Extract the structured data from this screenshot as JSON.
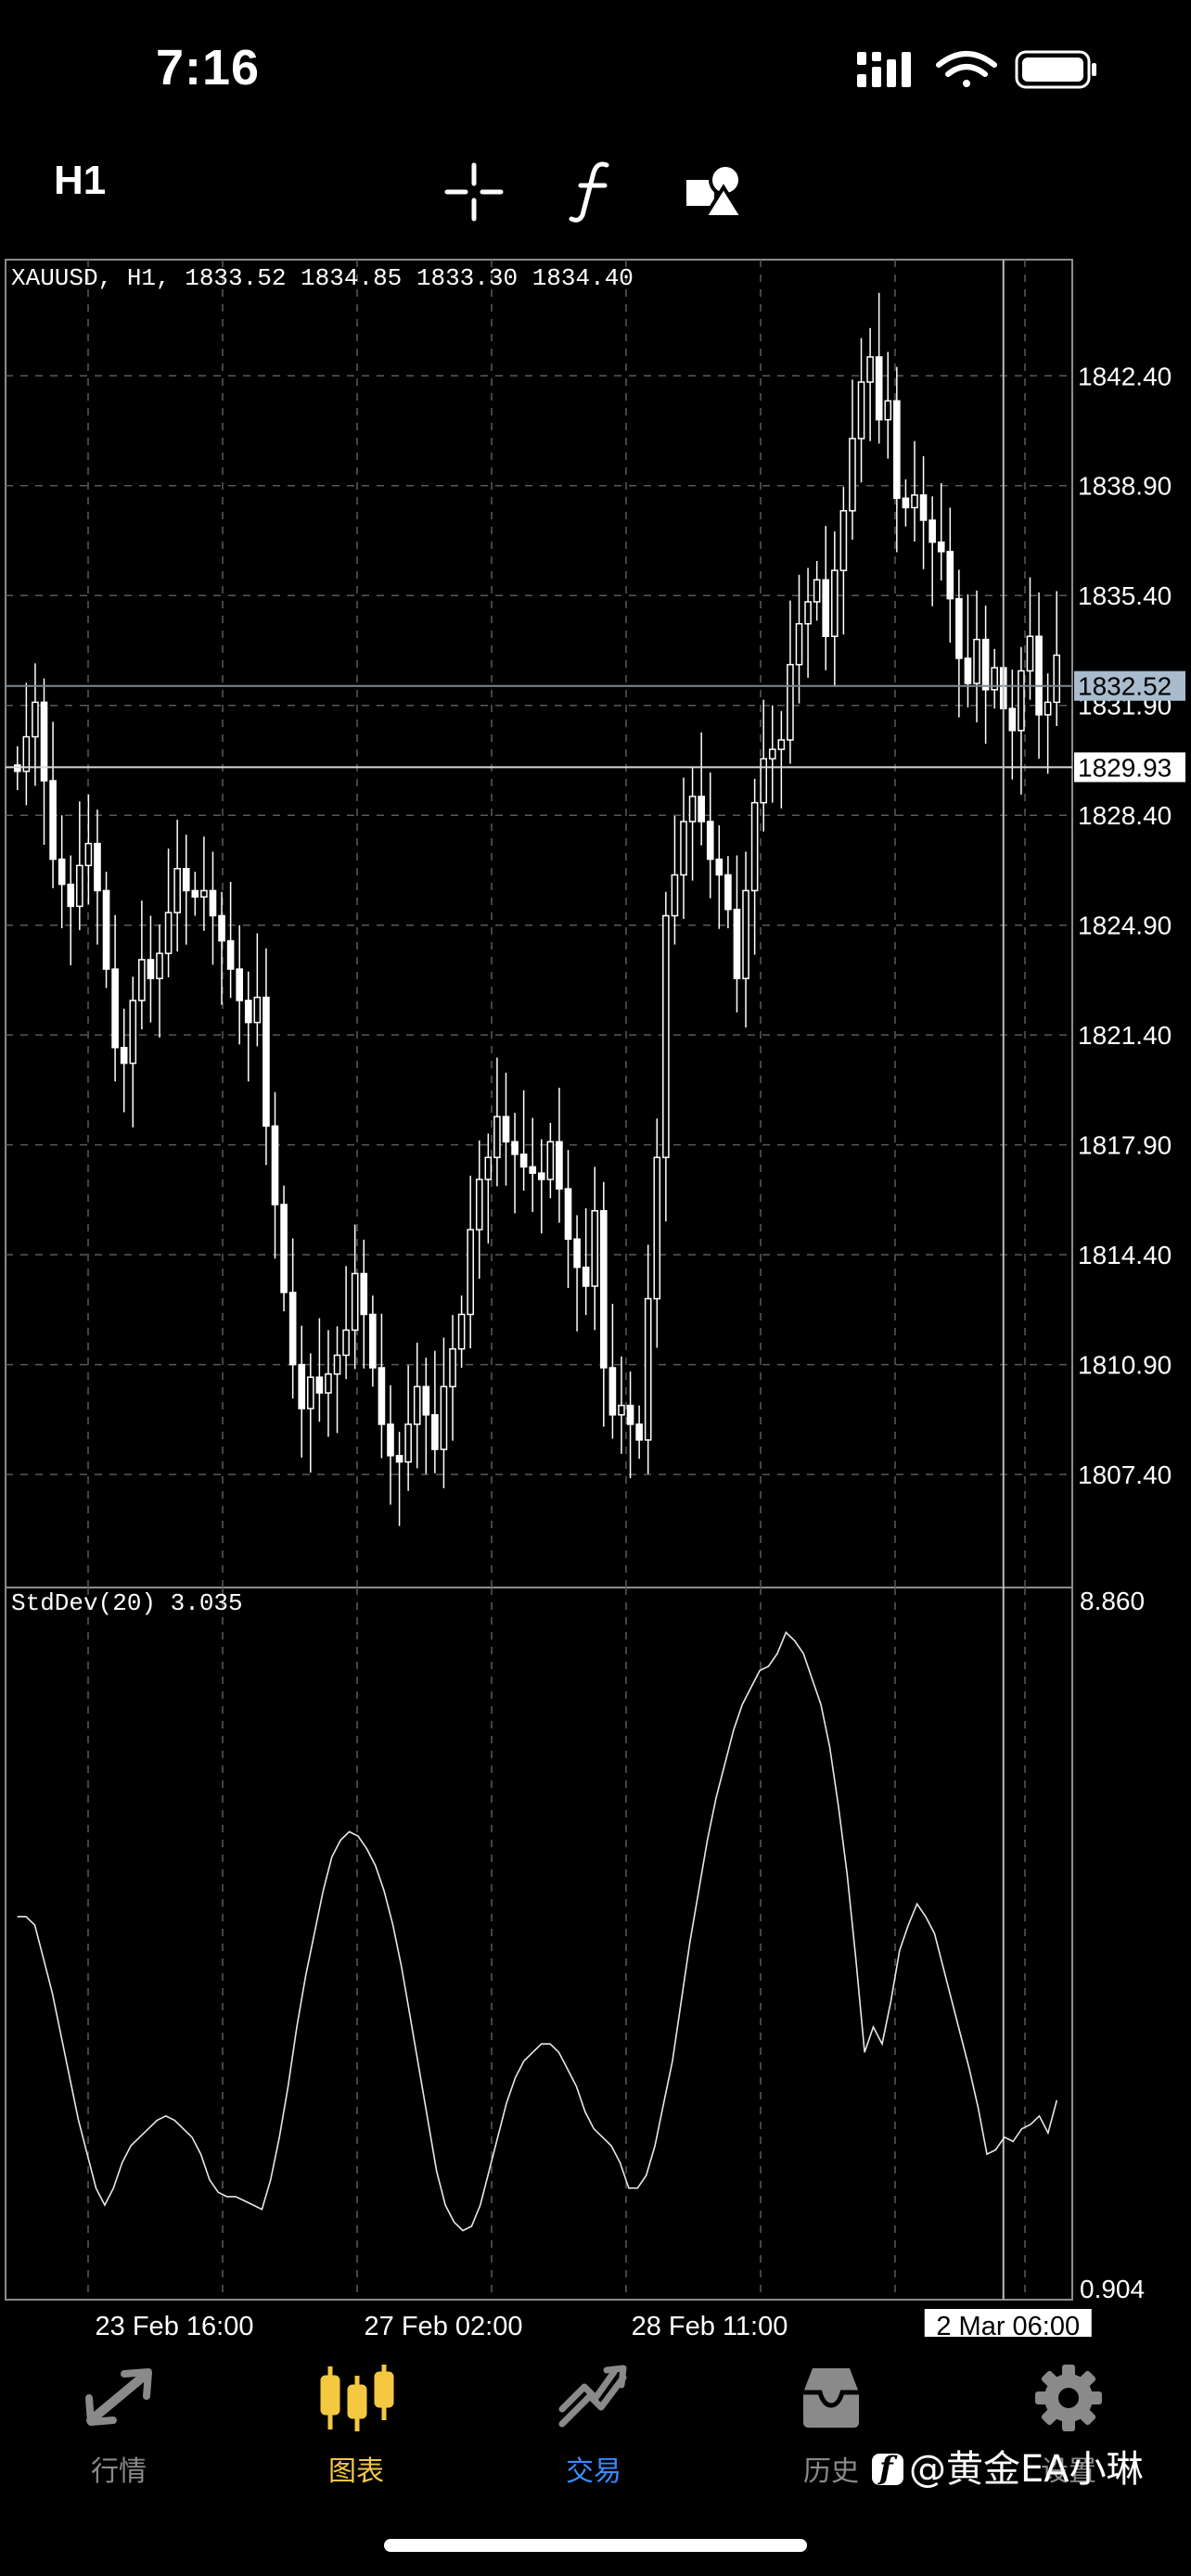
{
  "status_bar": {
    "time": "7:16"
  },
  "toolbar": {
    "timeframe": "H1",
    "icons": [
      "crosshair-icon",
      "function-icon",
      "objects-icon"
    ]
  },
  "chart_header": "XAUUSD, H1, 1833.52 1834.85 1833.30 1834.40",
  "indicator_header": "StdDev(20) 3.035",
  "current_price_label": "1832.52",
  "crosshair_price_label": "1829.93",
  "crosshair_time_label": "2 Mar 06:00",
  "chart_data": [
    {
      "type": "candlestick",
      "symbol": "XAUUSD",
      "timeframe": "H1",
      "ylim": [
        1803.8,
        1846.1
      ],
      "y_ticks": [
        "1842.40",
        "1838.90",
        "1835.40",
        "1831.90",
        "1828.40",
        "1824.90",
        "1821.40",
        "1817.90",
        "1814.40",
        "1810.90",
        "1807.40"
      ],
      "x_ticks": [
        "23 Feb 16:00",
        "27 Feb 02:00",
        "28 Feb 11:00"
      ],
      "current_price": 1832.52,
      "crosshair_price": 1829.93,
      "closes": [
        1829.8,
        1830.9,
        1832.0,
        1829.5,
        1827.0,
        1826.2,
        1825.5,
        1826.8,
        1827.5,
        1826.0,
        1823.5,
        1821.0,
        1820.5,
        1822.5,
        1823.8,
        1823.2,
        1824.0,
        1825.3,
        1826.7,
        1826.0,
        1825.8,
        1826.0,
        1825.2,
        1824.4,
        1823.5,
        1822.5,
        1821.8,
        1822.6,
        1818.5,
        1816.0,
        1813.2,
        1810.9,
        1809.5,
        1810.5,
        1810.0,
        1810.6,
        1811.2,
        1812.0,
        1813.8,
        1812.5,
        1810.8,
        1809.0,
        1808.0,
        1807.8,
        1809.0,
        1810.2,
        1809.3,
        1808.2,
        1810.2,
        1811.4,
        1812.5,
        1815.2,
        1816.8,
        1817.5,
        1818.8,
        1818.0,
        1817.6,
        1817.2,
        1817.0,
        1816.8,
        1818.0,
        1816.5,
        1814.9,
        1814.0,
        1813.4,
        1815.8,
        1810.8,
        1809.3,
        1809.6,
        1809.0,
        1808.5,
        1813.0,
        1817.5,
        1825.2,
        1826.5,
        1828.2,
        1829.0,
        1828.2,
        1827.0,
        1826.5,
        1825.4,
        1823.2,
        1826.0,
        1828.8,
        1830.2,
        1830.5,
        1830.8,
        1833.2,
        1834.5,
        1835.2,
        1835.9,
        1834.1,
        1836.2,
        1838.1,
        1840.4,
        1842.2,
        1843.0,
        1841.0,
        1841.6,
        1838.5,
        1838.2,
        1838.6,
        1837.8,
        1837.1,
        1836.8,
        1835.3,
        1833.4,
        1832.6,
        1834.0,
        1832.4,
        1833.1,
        1831.8,
        1831.1,
        1833.0,
        1834.1,
        1831.6,
        1832.0,
        1833.5
      ],
      "indicator": {
        "name": "StdDev(20)",
        "last_value": 3.035,
        "ylim": [
          0.904,
          8.86
        ],
        "values": [
          5.2,
          5.2,
          5.1,
          4.7,
          4.3,
          3.8,
          3.3,
          2.8,
          2.4,
          2.0,
          1.8,
          2.0,
          2.3,
          2.5,
          2.6,
          2.7,
          2.8,
          2.85,
          2.8,
          2.7,
          2.6,
          2.4,
          2.1,
          1.95,
          1.9,
          1.9,
          1.85,
          1.8,
          1.75,
          2.1,
          2.6,
          3.2,
          3.9,
          4.5,
          5.0,
          5.5,
          5.9,
          6.1,
          6.2,
          6.15,
          6.0,
          5.8,
          5.5,
          5.1,
          4.6,
          4.0,
          3.4,
          2.8,
          2.2,
          1.8,
          1.6,
          1.5,
          1.55,
          1.8,
          2.2,
          2.6,
          3.0,
          3.3,
          3.5,
          3.6,
          3.7,
          3.7,
          3.6,
          3.4,
          3.2,
          2.9,
          2.7,
          2.6,
          2.5,
          2.3,
          2.0,
          2.0,
          2.15,
          2.5,
          3.0,
          3.5,
          4.2,
          4.9,
          5.5,
          6.1,
          6.6,
          7.0,
          7.4,
          7.7,
          7.9,
          8.1,
          8.15,
          8.3,
          8.55,
          8.45,
          8.3,
          8.0,
          7.7,
          7.2,
          6.5,
          5.7,
          4.7,
          3.6,
          3.9,
          3.7,
          4.2,
          4.8,
          5.1,
          5.35,
          5.2,
          5.0,
          4.6,
          4.2,
          3.8,
          3.4,
          2.95,
          2.4,
          2.45,
          2.6,
          2.55,
          2.7,
          2.75,
          2.85,
          2.65,
          3.035
        ]
      }
    }
  ],
  "tabbar": {
    "tabs": [
      {
        "label": "行情",
        "icon": "quotes-icon"
      },
      {
        "label": "图表",
        "icon": "chart-candles-icon"
      },
      {
        "label": "交易",
        "icon": "trade-icon"
      },
      {
        "label": "历史",
        "icon": "history-icon"
      },
      {
        "label": "设置",
        "icon": "gear-icon"
      }
    ]
  },
  "watermark": "@黄金EA小琳",
  "colors": {
    "background": "#000000",
    "candle": "#ffffff",
    "active_tab": "#f5c842",
    "trade_tab": "#3b8bff"
  }
}
